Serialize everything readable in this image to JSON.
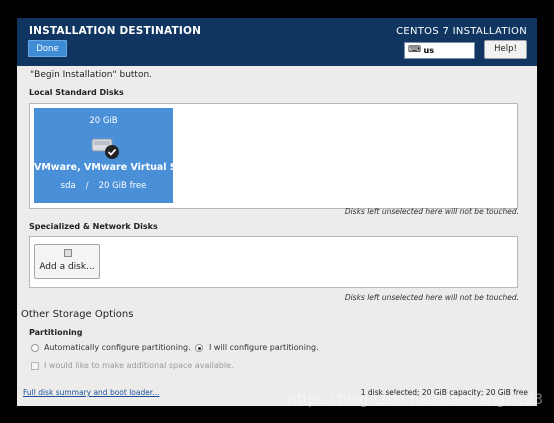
{
  "header": {
    "title": "INSTALLATION DESTINATION",
    "done_label": "Done",
    "subtitle": "CENTOS 7 INSTALLATION",
    "keyboard_layout": "us",
    "help_label": "Help!",
    "colors": {
      "bar": "#0f3560",
      "done": "#3e8bd6"
    }
  },
  "main": {
    "hint_text": "\"Begin Installation\" button.",
    "local_disks": {
      "label": "Local Standard Disks",
      "disks": [
        {
          "size": "20 GiB",
          "name": "VMware, VMware Virtual S",
          "device": "sda",
          "separator": "/",
          "free": "20 GiB free",
          "selected": true,
          "icon": "hard-drive-icon"
        }
      ],
      "note": "Disks left unselected here will not be touched."
    },
    "network_disks": {
      "label": "Specialized & Network Disks",
      "add_label": "Add a disk...",
      "note": "Disks left unselected here will not be touched."
    },
    "other_storage": {
      "title": "Other Storage Options",
      "partitioning_label": "Partitioning",
      "auto_option": "Automatically configure partitioning.",
      "manual_option": "I will configure partitioning.",
      "selected_option": "manual",
      "extra_space_option": "I would like to make additional space available."
    },
    "footer": {
      "link_text": "Full disk summary and boot loader...",
      "status_text": "1 disk selected; 20 GiB capacity; 20 GiB free"
    }
  },
  "watermark": "https://blog.csdn.net/xiaoxiangzi123"
}
